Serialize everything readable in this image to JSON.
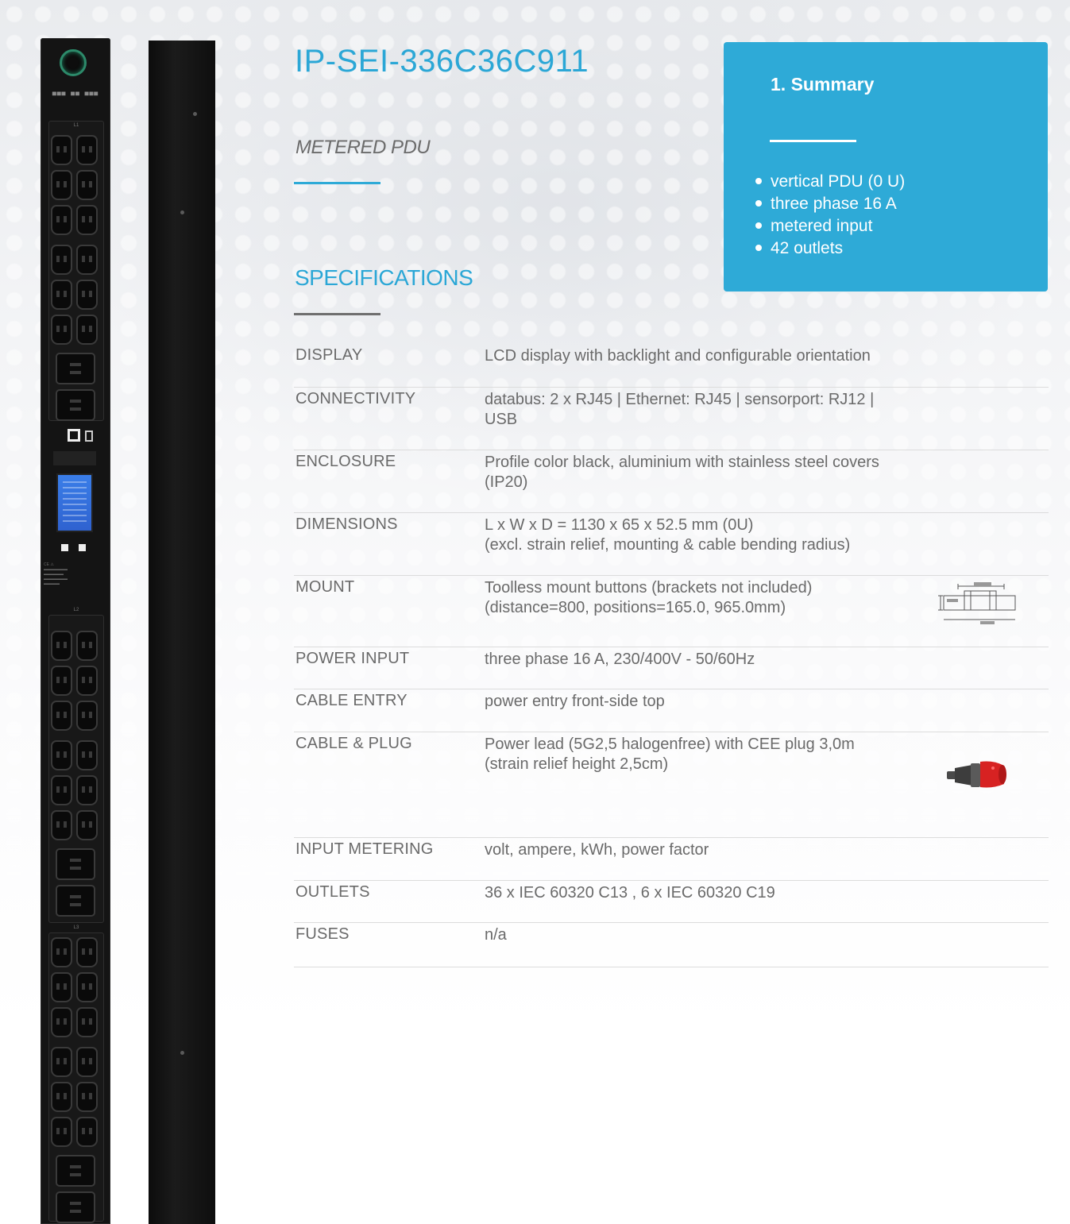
{
  "product": {
    "title": "IP-SEI-336C36C911",
    "subtitle": "METERED PDU"
  },
  "summary": {
    "heading": "1. Summary",
    "items": [
      "vertical PDU (0 U)",
      "three phase 16 A",
      "metered input",
      "42 outlets"
    ]
  },
  "specifications": {
    "heading": "SPECIFICATIONS",
    "rows": [
      {
        "label": "DISPLAY",
        "value": "LCD display with backlight and configurable orientation"
      },
      {
        "label": "CONNECTIVITY",
        "value": "databus: 2 x RJ45 | Ethernet: RJ45 | sensorport: RJ12 |\nUSB"
      },
      {
        "label": "ENCLOSURE",
        "value": "Profile color black, aluminium with stainless steel covers\n(IP20)"
      },
      {
        "label": "DIMENSIONS",
        "value": "L x W x D = 1130 x 65 x 52.5 mm (0U)\n(excl. strain relief, mounting & cable bending radius)"
      },
      {
        "label": "MOUNT",
        "value": "Toolless mount buttons (brackets not included)\n(distance=800, positions=165.0, 965.0mm)"
      },
      {
        "label": "POWER INPUT",
        "value": "three phase 16 A, 230/400V - 50/60Hz"
      },
      {
        "label": "CABLE ENTRY",
        "value": "power entry front-side top"
      },
      {
        "label": "CABLE & PLUG",
        "value": "Power lead (5G2,5 halogenfree) with CEE plug 3,0m\n(strain relief height 2,5cm)"
      },
      {
        "label": "INPUT METERING",
        "value": "volt, ampere, kWh, power factor"
      },
      {
        "label": "OUTLETS",
        "value": "36 x IEC 60320 C13 , 6 x IEC 60320 C19"
      },
      {
        "label": "FUSES",
        "value": "n/a"
      }
    ]
  },
  "pdu_image": {
    "bank_labels": [
      "L1",
      "L2",
      "L3"
    ]
  },
  "colors": {
    "accent": "#2eaad7",
    "text": "#6a6a6a",
    "pdu_body": "#141414"
  }
}
